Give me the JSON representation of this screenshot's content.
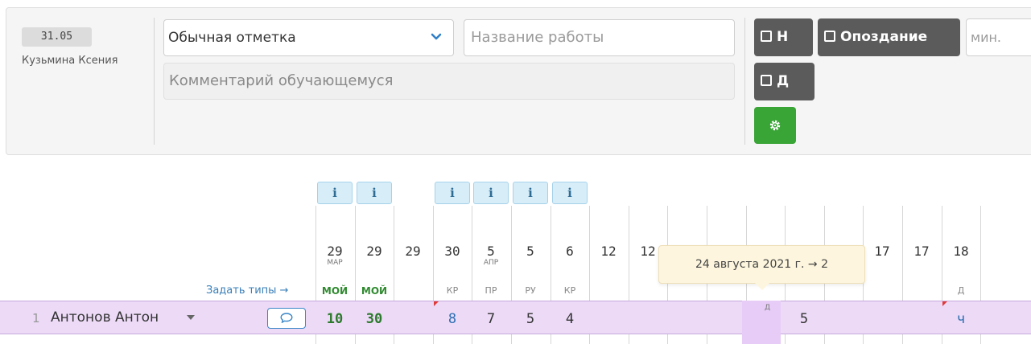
{
  "editor": {
    "date_badge": "31.05",
    "student_name": "Кузьмина Ксения",
    "mark_type_value": "Обычная отметка",
    "work_name_placeholder": "Название работы",
    "comment_placeholder": "Комментарий обучающемуся",
    "absent_n_label": "Н",
    "late_label": "Опоздание",
    "minutes_placeholder": "мин.",
    "remote_d_label": "Д",
    "settings_icon": "gear-icon",
    "chevron_icon": "chevron-down-icon"
  },
  "grid": {
    "set_types_label": "Задать типы →",
    "info_label": "i",
    "columns": [
      {
        "day": "29",
        "month": "МАР",
        "type": "МОЙ",
        "info": true
      },
      {
        "day": "29",
        "month": "",
        "type": "МОЙ",
        "info": true
      },
      {
        "day": "29",
        "month": "",
        "type": "",
        "info": false
      },
      {
        "day": "30",
        "month": "",
        "type": "КР",
        "info": true
      },
      {
        "day": "5",
        "month": "АПР",
        "type": "ПР",
        "info": true
      },
      {
        "day": "5",
        "month": "",
        "type": "РУ",
        "info": true
      },
      {
        "day": "6",
        "month": "",
        "type": "КР",
        "info": true
      },
      {
        "day": "12",
        "month": "",
        "type": "",
        "info": false
      },
      {
        "day": "12",
        "month": "",
        "type": "",
        "info": false
      },
      {
        "day": "",
        "month": "",
        "type": "",
        "info": false
      },
      {
        "day": "",
        "month": "",
        "type": "",
        "info": false
      },
      {
        "day": "",
        "month": "",
        "type": "",
        "info": false
      },
      {
        "day": "",
        "month": "",
        "type": "",
        "info": false
      },
      {
        "day": "17",
        "month": "",
        "type": "",
        "info": false
      },
      {
        "day": "17",
        "month": "",
        "type": "",
        "info": false
      },
      {
        "day": "17",
        "month": "",
        "type": "",
        "info": false
      },
      {
        "day": "18",
        "month": "",
        "type": "Д",
        "info": false
      }
    ],
    "rows": [
      {
        "num": "1",
        "name": "Антонов Антон",
        "grades": [
          "10",
          "30",
          "",
          "8",
          "7",
          "5",
          "4",
          "",
          "",
          "",
          "",
          "",
          "5",
          "",
          "",
          "",
          "ч"
        ],
        "cell_mark": "Д",
        "comment_icon": "comment-icon"
      }
    ],
    "tooltip": "24 августа 2021 г. → 2"
  }
}
